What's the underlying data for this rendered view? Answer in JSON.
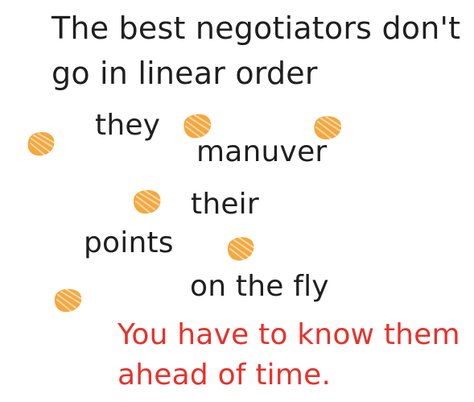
{
  "heading": {
    "line1": "The best negotiators don't",
    "line2": "go in linear order"
  },
  "words": {
    "they": "they",
    "manuver": "manuver",
    "their": "their",
    "points": "points",
    "on_the_fly": "on the fly"
  },
  "conclusion": {
    "line1": "You have to know them",
    "line2": "ahead of time."
  },
  "colors": {
    "text": "#1f1f1f",
    "accent": "#e8312a",
    "blob": "#f4a83e"
  },
  "icons": [
    "orange-blob-icon"
  ]
}
